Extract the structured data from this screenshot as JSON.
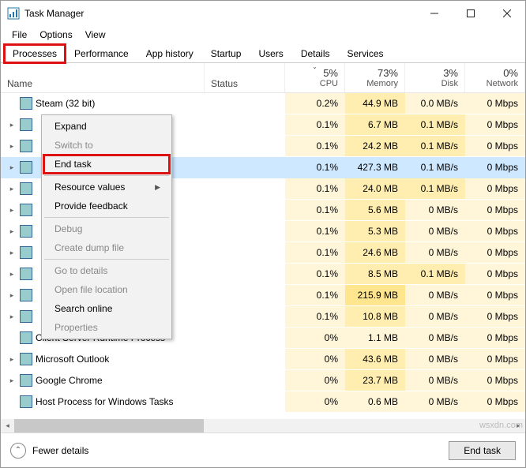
{
  "window": {
    "title": "Task Manager"
  },
  "menubar": [
    "File",
    "Options",
    "View"
  ],
  "tabs": [
    "Processes",
    "Performance",
    "App history",
    "Startup",
    "Users",
    "Details",
    "Services"
  ],
  "active_tab": 0,
  "columns": {
    "name": "Name",
    "status": "Status",
    "metrics": [
      {
        "pct": "5%",
        "label": "CPU",
        "sort": true
      },
      {
        "pct": "73%",
        "label": "Memory"
      },
      {
        "pct": "3%",
        "label": "Disk"
      },
      {
        "pct": "0%",
        "label": "Network"
      }
    ]
  },
  "rows": [
    {
      "name": "Steam (32 bit)",
      "cpu": "0.2%",
      "cpu_s": 1,
      "mem": "44.9 MB",
      "mem_s": 2,
      "disk": "0.0 MB/s",
      "disk_s": 1,
      "net": "0 Mbps",
      "net_s": 1,
      "exp": "",
      "sel": false
    },
    {
      "name": "",
      "cpu": "0.1%",
      "cpu_s": 1,
      "mem": "6.7 MB",
      "mem_s": 2,
      "disk": "0.1 MB/s",
      "disk_s": 2,
      "net": "0 Mbps",
      "net_s": 1,
      "exp": "▸",
      "sel": false
    },
    {
      "name": "",
      "cpu": "0.1%",
      "cpu_s": 1,
      "mem": "24.2 MB",
      "mem_s": 2,
      "disk": "0.1 MB/s",
      "disk_s": 2,
      "net": "0 Mbps",
      "net_s": 1,
      "exp": "▸",
      "sel": false
    },
    {
      "name": "",
      "cpu": "0.1%",
      "cpu_s": 1,
      "mem": "427.3 MB",
      "mem_s": 3,
      "disk": "0.1 MB/s",
      "disk_s": 2,
      "net": "0 Mbps",
      "net_s": 1,
      "exp": "▸",
      "sel": true
    },
    {
      "name": "",
      "cpu": "0.1%",
      "cpu_s": 1,
      "mem": "24.0 MB",
      "mem_s": 2,
      "disk": "0.1 MB/s",
      "disk_s": 2,
      "net": "0 Mbps",
      "net_s": 1,
      "exp": "▸",
      "sel": false
    },
    {
      "name": "",
      "cpu": "0.1%",
      "cpu_s": 1,
      "mem": "5.6 MB",
      "mem_s": 2,
      "disk": "0 MB/s",
      "disk_s": 1,
      "net": "0 Mbps",
      "net_s": 1,
      "exp": "▸",
      "sel": false
    },
    {
      "name": "",
      "cpu": "0.1%",
      "cpu_s": 1,
      "mem": "5.3 MB",
      "mem_s": 2,
      "disk": "0 MB/s",
      "disk_s": 1,
      "net": "0 Mbps",
      "net_s": 1,
      "exp": "▸",
      "sel": false
    },
    {
      "name": "",
      "cpu": "0.1%",
      "cpu_s": 1,
      "mem": "24.6 MB",
      "mem_s": 2,
      "disk": "0 MB/s",
      "disk_s": 1,
      "net": "0 Mbps",
      "net_s": 1,
      "exp": "▸",
      "sel": false
    },
    {
      "name": "",
      "cpu": "0.1%",
      "cpu_s": 1,
      "mem": "8.5 MB",
      "mem_s": 2,
      "disk": "0.1 MB/s",
      "disk_s": 2,
      "net": "0 Mbps",
      "net_s": 1,
      "exp": "▸",
      "sel": false
    },
    {
      "name": "",
      "cpu": "0.1%",
      "cpu_s": 1,
      "mem": "215.9 MB",
      "mem_s": 3,
      "disk": "0 MB/s",
      "disk_s": 1,
      "net": "0 Mbps",
      "net_s": 1,
      "exp": "▸",
      "sel": false
    },
    {
      "name": "",
      "cpu": "0.1%",
      "cpu_s": 1,
      "mem": "10.8 MB",
      "mem_s": 2,
      "disk": "0 MB/s",
      "disk_s": 1,
      "net": "0 Mbps",
      "net_s": 1,
      "exp": "▸",
      "sel": false
    },
    {
      "name": "Client Server Runtime Process",
      "cpu": "0%",
      "cpu_s": 1,
      "mem": "1.1 MB",
      "mem_s": 1,
      "disk": "0 MB/s",
      "disk_s": 1,
      "net": "0 Mbps",
      "net_s": 1,
      "exp": "",
      "sel": false
    },
    {
      "name": "Microsoft Outlook",
      "cpu": "0%",
      "cpu_s": 1,
      "mem": "43.6 MB",
      "mem_s": 2,
      "disk": "0 MB/s",
      "disk_s": 1,
      "net": "0 Mbps",
      "net_s": 1,
      "exp": "▸",
      "sel": false
    },
    {
      "name": "Google Chrome",
      "cpu": "0%",
      "cpu_s": 1,
      "mem": "23.7 MB",
      "mem_s": 2,
      "disk": "0 MB/s",
      "disk_s": 1,
      "net": "0 Mbps",
      "net_s": 1,
      "exp": "▸",
      "sel": false
    },
    {
      "name": "Host Process for Windows Tasks",
      "cpu": "0%",
      "cpu_s": 1,
      "mem": "0.6 MB",
      "mem_s": 1,
      "disk": "0 MB/s",
      "disk_s": 1,
      "net": "0 Mbps",
      "net_s": 1,
      "exp": "",
      "sel": false
    }
  ],
  "context_menu": [
    {
      "label": "Expand",
      "enabled": true,
      "sub": false,
      "hl": false
    },
    {
      "label": "Switch to",
      "enabled": false,
      "sub": false,
      "hl": false
    },
    {
      "label": "End task",
      "enabled": true,
      "sub": false,
      "hl": true
    },
    {
      "sep": true
    },
    {
      "label": "Resource values",
      "enabled": true,
      "sub": true,
      "hl": false
    },
    {
      "label": "Provide feedback",
      "enabled": true,
      "sub": false,
      "hl": false
    },
    {
      "sep": true
    },
    {
      "label": "Debug",
      "enabled": false,
      "sub": false,
      "hl": false
    },
    {
      "label": "Create dump file",
      "enabled": false,
      "sub": false,
      "hl": false
    },
    {
      "sep": true
    },
    {
      "label": "Go to details",
      "enabled": false,
      "sub": false,
      "hl": false
    },
    {
      "label": "Open file location",
      "enabled": false,
      "sub": false,
      "hl": false
    },
    {
      "label": "Search online",
      "enabled": true,
      "sub": false,
      "hl": false
    },
    {
      "label": "Properties",
      "enabled": false,
      "sub": false,
      "hl": false
    }
  ],
  "footer": {
    "fewer": "Fewer details",
    "end_task": "End task"
  },
  "watermark": "wsxdn.com"
}
